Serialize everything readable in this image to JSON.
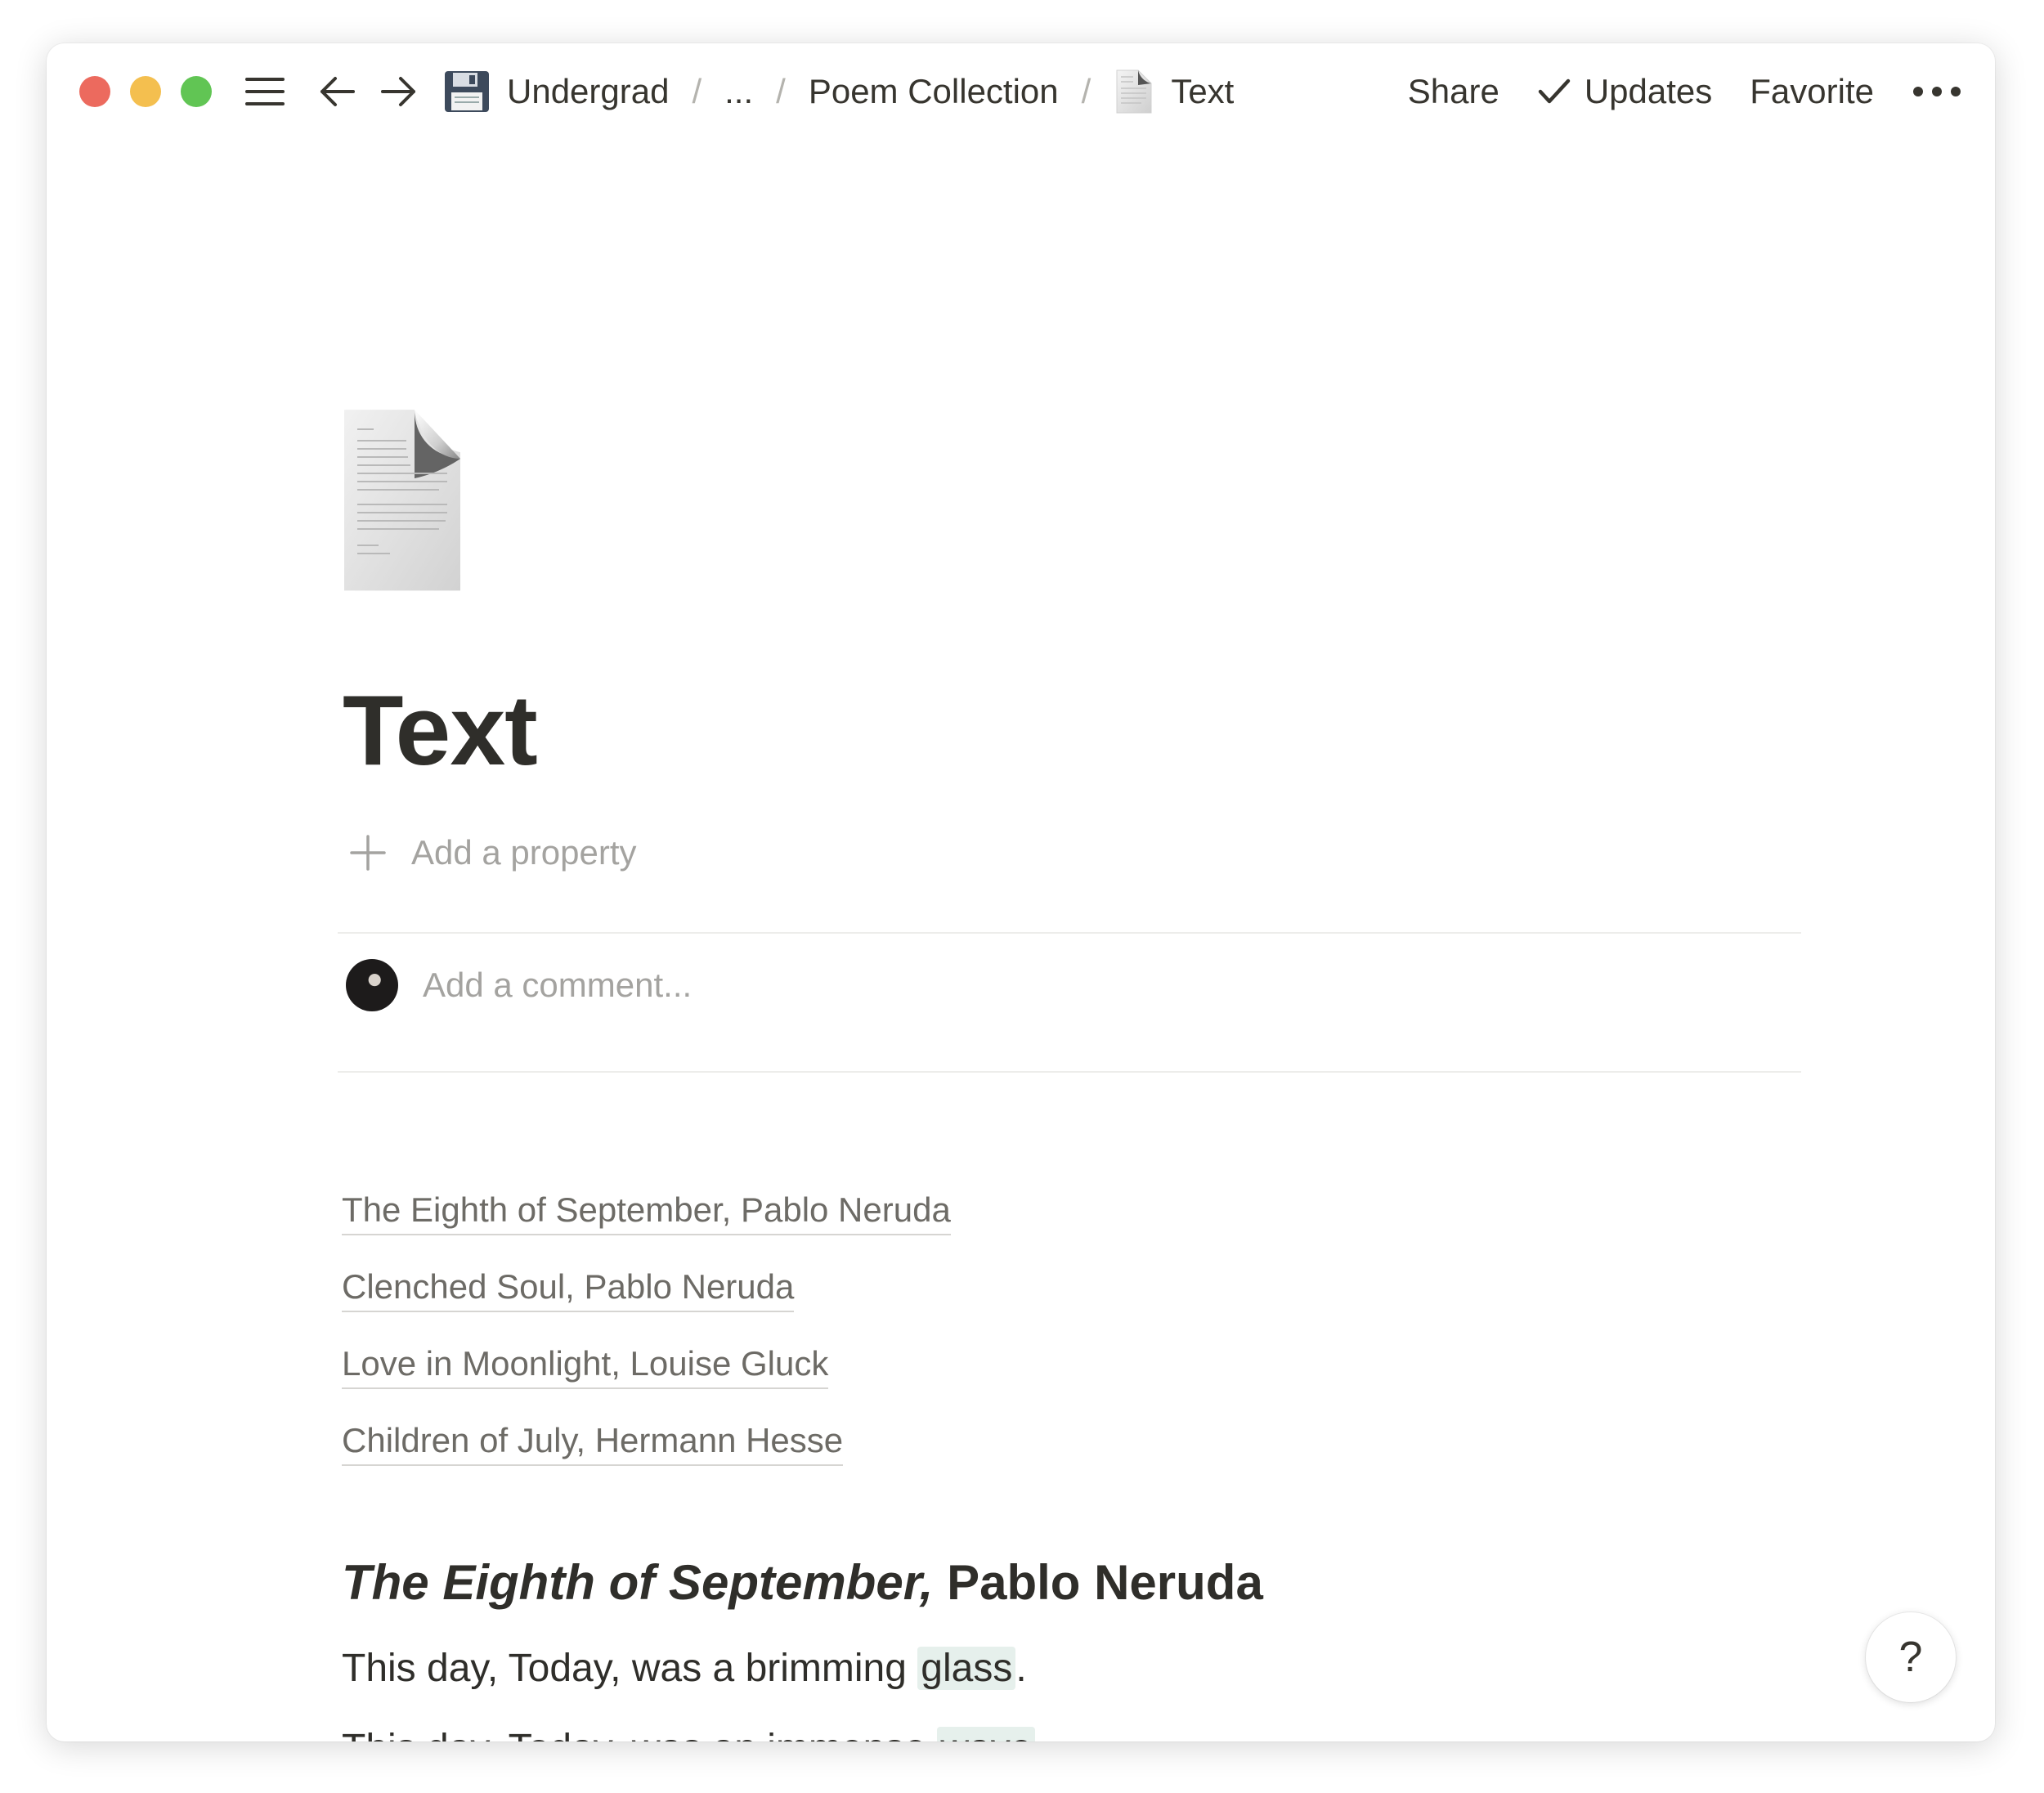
{
  "window": {
    "traffic_lights": {
      "close_color": "#ec6a5e",
      "minimize_color": "#f4bf4f",
      "maximize_color": "#61c554"
    }
  },
  "toolbar": {
    "breadcrumbs": [
      {
        "label": "Undergrad",
        "icon": "floppy-disk-icon"
      },
      {
        "label": "..."
      },
      {
        "label": "Poem Collection"
      },
      {
        "label": "Text",
        "icon": "document-icon"
      }
    ],
    "separator": "/",
    "share_label": "Share",
    "updates_label": "Updates",
    "favorite_label": "Favorite"
  },
  "page": {
    "icon": "document-page-icon",
    "title": "Text",
    "add_property_label": "Add a property",
    "comment_placeholder": "Add a comment..."
  },
  "links": [
    "The Eighth of September, Pablo Neruda",
    "Clenched Soul, Pablo Neruda",
    "Love in Moonlight, Louise Gluck",
    "Children of July, Hermann Hesse"
  ],
  "poem": {
    "heading_italic": "The Eighth of September,",
    "heading_rest": " Pablo Neruda",
    "lines": [
      {
        "before": "This day, Today, was a brimming ",
        "highlight": "glass",
        "after": "."
      },
      {
        "before": "This day, Today, was an immense ",
        "highlight": "wave",
        "after": "."
      }
    ]
  },
  "help_label": "?",
  "colors": {
    "text": "#37352f",
    "muted": "#a4a3a0",
    "highlight": "#e6f0ec"
  }
}
